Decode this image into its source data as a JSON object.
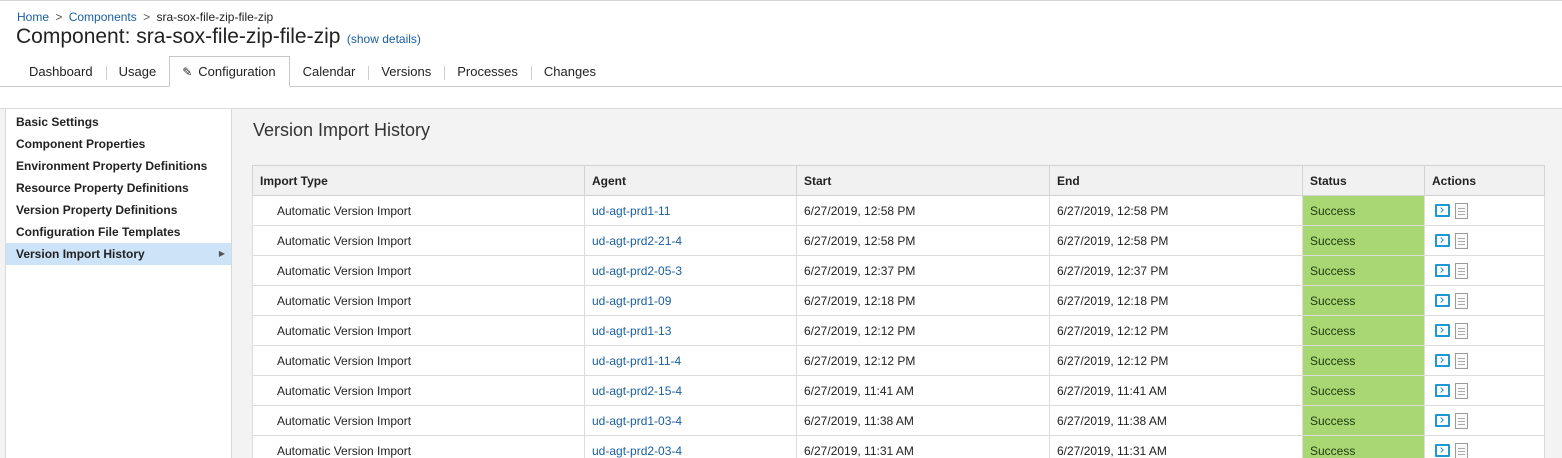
{
  "breadcrumb": {
    "home": "Home",
    "separator1": ">",
    "components": "Components",
    "separator2": ">",
    "current": "sra-sox-file-zip-file-zip"
  },
  "page": {
    "title": "Component: sra-sox-file-zip-file-zip",
    "show_details": "(show details)"
  },
  "tabs": [
    {
      "label": "Dashboard",
      "active": false
    },
    {
      "label": "Usage",
      "active": false
    },
    {
      "label": "Configuration",
      "active": true,
      "icon": "pencil-icon"
    },
    {
      "label": "Calendar",
      "active": false
    },
    {
      "label": "Versions",
      "active": false
    },
    {
      "label": "Processes",
      "active": false
    },
    {
      "label": "Changes",
      "active": false
    }
  ],
  "sidebar": {
    "items": [
      {
        "label": "Basic Settings"
      },
      {
        "label": "Component Properties"
      },
      {
        "label": "Environment Property Definitions"
      },
      {
        "label": "Resource Property Definitions"
      },
      {
        "label": "Version Property Definitions"
      },
      {
        "label": "Configuration File Templates"
      },
      {
        "label": "Version Import History",
        "active": true,
        "arrow": "▶"
      }
    ]
  },
  "main": {
    "section_title": "Version Import History",
    "columns": [
      "Import Type",
      "Agent",
      "Start",
      "End",
      "Status",
      "Actions"
    ],
    "rows": [
      {
        "type": "Automatic Version Import",
        "agent": "ud-agt-prd1-11",
        "start": "6/27/2019, 12:58 PM",
        "end": "6/27/2019, 12:58 PM",
        "status": "Success"
      },
      {
        "type": "Automatic Version Import",
        "agent": "ud-agt-prd2-21-4",
        "start": "6/27/2019, 12:58 PM",
        "end": "6/27/2019, 12:58 PM",
        "status": "Success"
      },
      {
        "type": "Automatic Version Import",
        "agent": "ud-agt-prd2-05-3",
        "start": "6/27/2019, 12:37 PM",
        "end": "6/27/2019, 12:37 PM",
        "status": "Success"
      },
      {
        "type": "Automatic Version Import",
        "agent": "ud-agt-prd1-09",
        "start": "6/27/2019, 12:18 PM",
        "end": "6/27/2019, 12:18 PM",
        "status": "Success"
      },
      {
        "type": "Automatic Version Import",
        "agent": "ud-agt-prd1-13",
        "start": "6/27/2019, 12:12 PM",
        "end": "6/27/2019, 12:12 PM",
        "status": "Success"
      },
      {
        "type": "Automatic Version Import",
        "agent": "ud-agt-prd1-11-4",
        "start": "6/27/2019, 12:12 PM",
        "end": "6/27/2019, 12:12 PM",
        "status": "Success"
      },
      {
        "type": "Automatic Version Import",
        "agent": "ud-agt-prd2-15-4",
        "start": "6/27/2019, 11:41 AM",
        "end": "6/27/2019, 11:41 AM",
        "status": "Success"
      },
      {
        "type": "Automatic Version Import",
        "agent": "ud-agt-prd1-03-4",
        "start": "6/27/2019, 11:38 AM",
        "end": "6/27/2019, 11:38 AM",
        "status": "Success"
      },
      {
        "type": "Automatic Version Import",
        "agent": "ud-agt-prd2-03-4",
        "start": "6/27/2019, 11:31 AM",
        "end": "6/27/2019, 11:31 AM",
        "status": "Success"
      }
    ],
    "action_icons": [
      "view-output-icon",
      "log-document-icon"
    ]
  },
  "colors": {
    "link": "#1a5fa2",
    "status_success": "#a8d774",
    "sidebar_active": "#cde3f7",
    "action_icon": "#1f97d4"
  }
}
